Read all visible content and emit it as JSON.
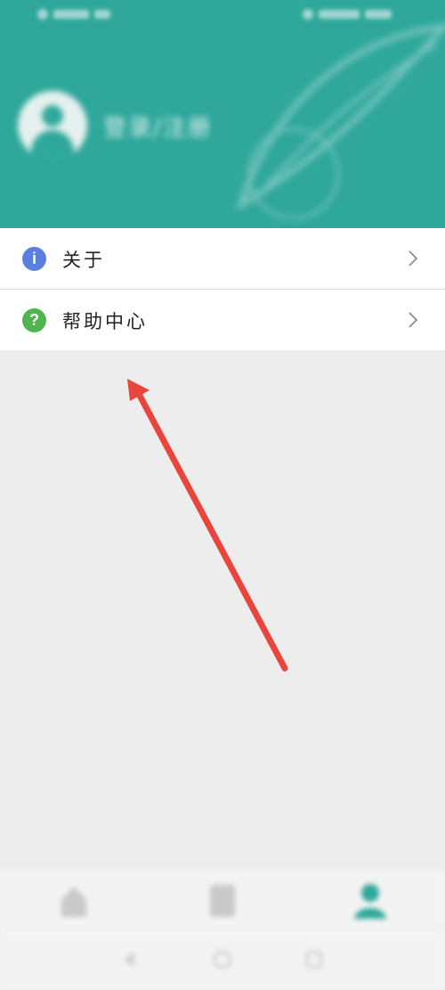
{
  "profile": {
    "name": "登录/注册"
  },
  "menu": {
    "items": [
      {
        "icon": "info-icon",
        "label": "关于"
      },
      {
        "icon": "help-icon",
        "label": "帮助中心"
      }
    ]
  },
  "bottom_nav": {
    "tabs": [
      {
        "icon": "home-icon"
      },
      {
        "icon": "document-icon"
      },
      {
        "icon": "profile-icon"
      }
    ]
  },
  "colors": {
    "header": "#2fa79b",
    "info_icon": "#5b7fe0",
    "help_icon": "#4fb54f",
    "arrow": "#e8453c",
    "active_tab": "#2fa79b"
  }
}
